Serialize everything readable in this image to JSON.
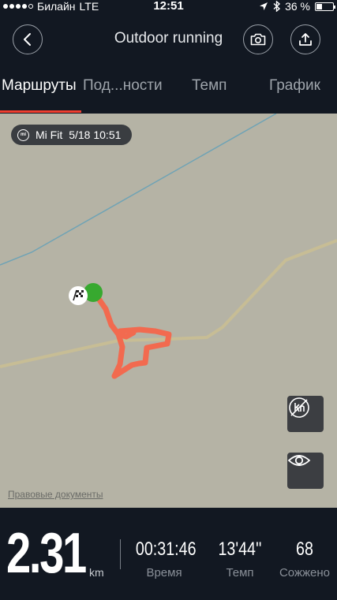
{
  "status_bar": {
    "carrier": "Билайн",
    "network": "LTE",
    "time": "12:51",
    "battery": "36 %",
    "battery_level": 0.36
  },
  "header": {
    "title": "Outdoor running"
  },
  "tabs": [
    {
      "label": "Маршруты",
      "active": true
    },
    {
      "label": "Под...ности",
      "active": false
    },
    {
      "label": "Темп",
      "active": false
    },
    {
      "label": "График",
      "active": false
    }
  ],
  "map": {
    "source_badge": "Mi Fit",
    "mi_logo": "mi",
    "timestamp": "5/18 10:51",
    "legal_link": "Правовые документы",
    "route_color": "#f26a4f",
    "start_color": "#37a92f"
  },
  "stats": {
    "distance": "2.31",
    "distance_unit": "km",
    "duration": "00:31:46",
    "duration_label": "Время",
    "pace": "13'44''",
    "pace_label": "Темп",
    "calories": "68",
    "calories_label": "Сожжено"
  },
  "colors": {
    "accent": "#ef3e2f",
    "background": "#121822",
    "map_background": "#b5b3a5"
  }
}
